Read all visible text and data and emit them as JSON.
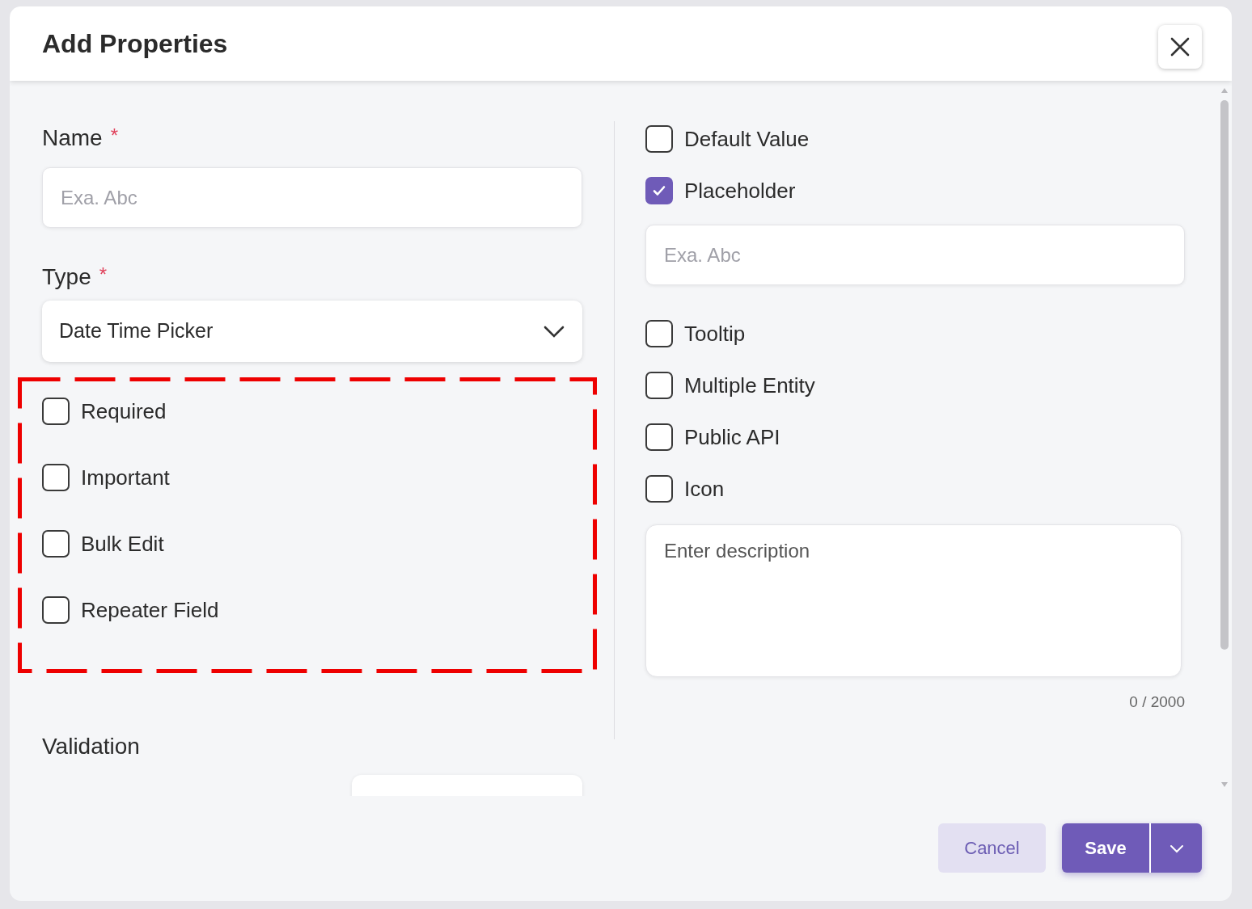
{
  "dialog": {
    "title": "Add Properties"
  },
  "left": {
    "fields": [
      {
        "kind": "input",
        "label": "Name",
        "required_mark": "*",
        "placeholder": "Exa. Abc"
      },
      {
        "kind": "select",
        "label": "Type",
        "required_mark": "*",
        "value": "Date Time Picker"
      }
    ],
    "options": [
      {
        "label": "Required",
        "checked": false
      },
      {
        "label": "Important",
        "checked": false
      },
      {
        "label": "Bulk Edit",
        "checked": false
      },
      {
        "label": "Repeater Field",
        "checked": false
      }
    ],
    "validation": {
      "title": "Validation"
    }
  },
  "right": {
    "options": [
      {
        "label": "Default Value",
        "checked": false
      },
      {
        "label": "Placeholder",
        "checked": true,
        "placeholder": "Exa. Abc"
      },
      {
        "label": "Tooltip",
        "checked": false
      },
      {
        "label": "Multiple Entity",
        "checked": false
      },
      {
        "label": "Public API",
        "checked": false
      },
      {
        "label": "Icon",
        "checked": false
      }
    ],
    "description": {
      "placeholder": "Enter description",
      "counter": "0 / 2000"
    }
  },
  "footer": {
    "cancel": "Cancel",
    "save": "Save"
  }
}
